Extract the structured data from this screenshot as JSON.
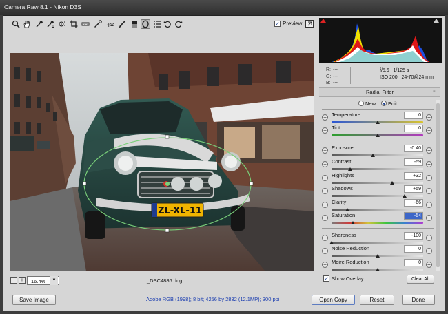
{
  "window": {
    "title": "Camera Raw 8.1  -  Nikon D3S"
  },
  "toolbar": {
    "tools": [
      "zoom-tool",
      "hand-tool",
      "white-balance-tool",
      "color-sampler-tool",
      "targeted-adjustment-tool",
      "crop-tool",
      "straighten-tool",
      "spot-removal-tool",
      "red-eye-removal-tool",
      "adjustment-brush-tool",
      "graduated-filter-tool",
      "radial-filter-tool",
      "preferences-tool",
      "rotate-ccw-tool",
      "rotate-cw-tool"
    ],
    "preview_label": "Preview",
    "preview_checked": true
  },
  "image": {
    "plate": "ZL-XL-11"
  },
  "zoom": {
    "value": "16.4%",
    "filename": "_DSC4886.dng"
  },
  "info": {
    "rgb_labels": [
      "R:",
      "G:",
      "B:"
    ],
    "rgb_values": [
      "---",
      "---",
      "---"
    ],
    "aperture": "f/5.6",
    "shutter": "1/125 s",
    "iso": "ISO 200",
    "lens": "24-70@24 mm"
  },
  "panel": {
    "title": "Radial Filter",
    "new_label": "New",
    "edit_label": "Edit",
    "mode_selected": "edit"
  },
  "sliders": [
    {
      "key": "temperature",
      "label": "Temperature",
      "value": "0",
      "level": 0.5
    },
    {
      "key": "tint",
      "label": "Tint",
      "value": "0",
      "level": 0.5
    },
    {
      "key": "exposure",
      "label": "Exposure",
      "value": "-0.40",
      "level": 0.45
    },
    {
      "key": "contrast",
      "label": "Contrast",
      "value": "-59",
      "level": 0.205
    },
    {
      "key": "highlights",
      "label": "Highlights",
      "value": "+32",
      "level": 0.66
    },
    {
      "key": "shadows",
      "label": "Shadows",
      "value": "+59",
      "level": 0.795
    },
    {
      "key": "clarity",
      "label": "Clarity",
      "value": "-66",
      "level": 0.17
    },
    {
      "key": "saturation",
      "label": "Saturation",
      "value": "-54",
      "level": 0.23
    },
    {
      "key": "sharpness",
      "label": "Sharpness",
      "value": "-100",
      "level": 0.0
    },
    {
      "key": "noise-reduction",
      "label": "Noise Reduction",
      "value": "0",
      "level": 0.5
    },
    {
      "key": "moire-reduction",
      "label": "Moire Reduction",
      "value": "0",
      "level": 0.5
    }
  ],
  "overlay": {
    "label": "Show Overlay",
    "checked": true,
    "clear_label": "Clear All"
  },
  "footer": {
    "save_label": "Save Image",
    "workflow": "Adobe RGB (1998); 8 bit; 4256 by 2832 (12.1MP); 300 ppi",
    "open_label": "Open Copy",
    "reset_label": "Reset",
    "done_label": "Done"
  }
}
